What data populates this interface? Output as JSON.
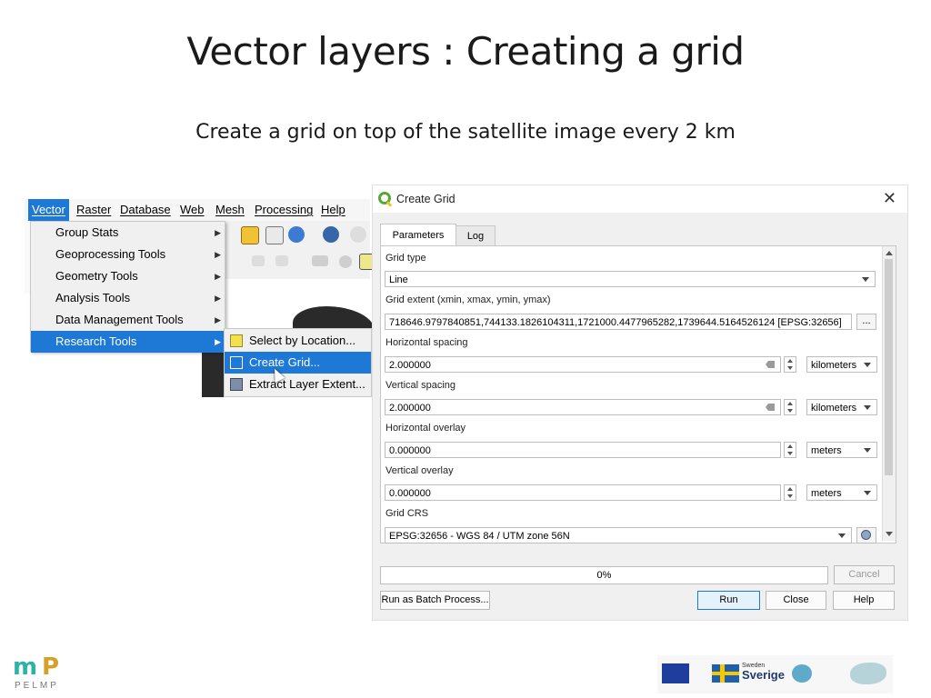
{
  "slide": {
    "title": "Vector layers : Creating a grid",
    "subtitle": "Create a grid on top of the satellite image every 2 km"
  },
  "menu": {
    "bar": [
      "Vector",
      "Raster",
      "Database",
      "Web",
      "Mesh",
      "Processing",
      "Help"
    ],
    "vector_items": [
      "Group Stats",
      "Geoprocessing Tools",
      "Geometry Tools",
      "Analysis Tools",
      "Data Management Tools",
      "Research Tools"
    ],
    "research_items": [
      "Select by Location...",
      "Create Grid...",
      "Extract Layer Extent..."
    ]
  },
  "dialog": {
    "title": "Create Grid",
    "tabs": [
      "Parameters",
      "Log"
    ],
    "grid_type_label": "Grid type",
    "grid_type_value": "Line",
    "extent_label": "Grid extent (xmin, xmax, ymin, ymax)",
    "extent_value": "718646.9797840851,744133.1826104311,1721000.4477965282,1739644.5164526124 [EPSG:32656]",
    "extent_button": "...",
    "hspacing_label": "Horizontal spacing",
    "hspacing_value": "2.000000",
    "hspacing_unit": "kilometers",
    "vspacing_label": "Vertical spacing",
    "vspacing_value": "2.000000",
    "vspacing_unit": "kilometers",
    "hoverlay_label": "Horizontal overlay",
    "hoverlay_value": "0.000000",
    "hoverlay_unit": "meters",
    "voverlay_label": "Vertical overlay",
    "voverlay_value": "0.000000",
    "voverlay_unit": "meters",
    "crs_label": "Grid CRS",
    "crs_value": "EPSG:32656 - WGS 84 / UTM zone 56N",
    "progress_text": "0%",
    "progress_fraction": 0,
    "buttons": {
      "cancel": "Cancel",
      "batch": "Run as Batch Process...",
      "run": "Run",
      "close": "Close",
      "help": "Help"
    }
  },
  "footer": {
    "mp_logo_text": "PELMP",
    "sweden_small": "Sweden",
    "sweden_word": "Sverige"
  },
  "colors": {
    "menu_highlight": "#1e78d6",
    "qgis_green": "#5aa834"
  }
}
